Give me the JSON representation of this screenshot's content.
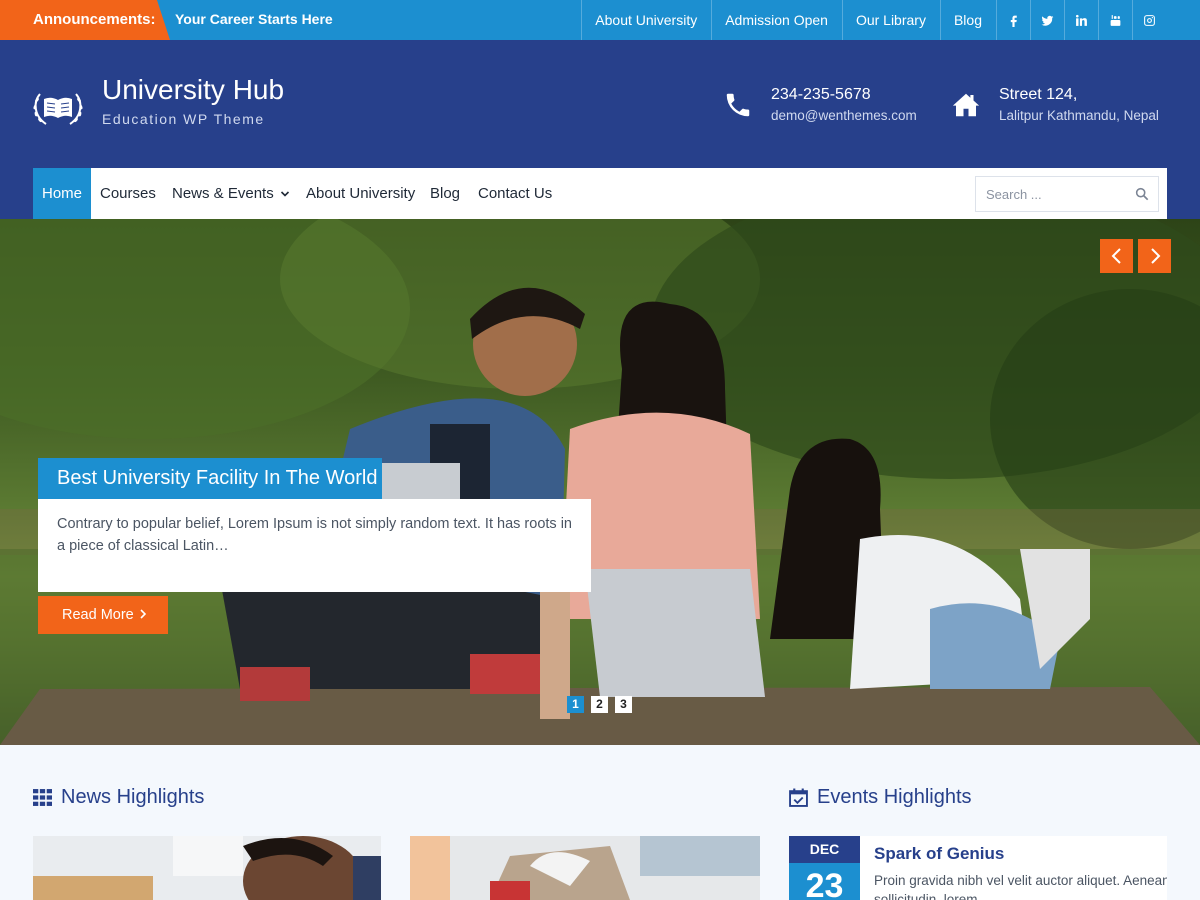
{
  "topbar": {
    "announcement_label": "Announcements:",
    "announcement_text": "Your Career Starts Here",
    "links": [
      "About University",
      "Admission Open",
      "Our Library",
      "Blog"
    ],
    "social_icons": [
      "facebook-icon",
      "twitter-icon",
      "linkedin-icon",
      "youtube-icon",
      "instagram-icon"
    ]
  },
  "header": {
    "site_title": "University Hub",
    "tagline": "Education WP Theme",
    "phone": "234-235-5678",
    "email": "demo@wenthemes.com",
    "address_line1": "Street 124,",
    "address_line2": "Lalitpur Kathmandu, Nepal"
  },
  "nav": {
    "items": [
      "Home",
      "Courses",
      "News & Events",
      "About University",
      "Blog",
      "Contact Us"
    ],
    "active": "Home",
    "search_placeholder": "Search ..."
  },
  "slider": {
    "title": "Best University Facility In The World",
    "text": "Contrary to popular belief, Lorem Ipsum is not simply random text. It has roots in a piece of classical Latin…",
    "button": "Read More",
    "pages": [
      "1",
      "2",
      "3"
    ],
    "active_page": "1"
  },
  "sections": {
    "news_title": "News Highlights",
    "events_title": "Events Highlights"
  },
  "event": {
    "month": "DEC",
    "day": "23",
    "title": "Spark of Genius",
    "text": "Proin gravida nibh vel velit auctor aliquet. Aenean sollicitudin, lorem"
  },
  "colors": {
    "primary_blue": "#1c8fd0",
    "navy": "#27408b",
    "orange": "#f26419"
  }
}
